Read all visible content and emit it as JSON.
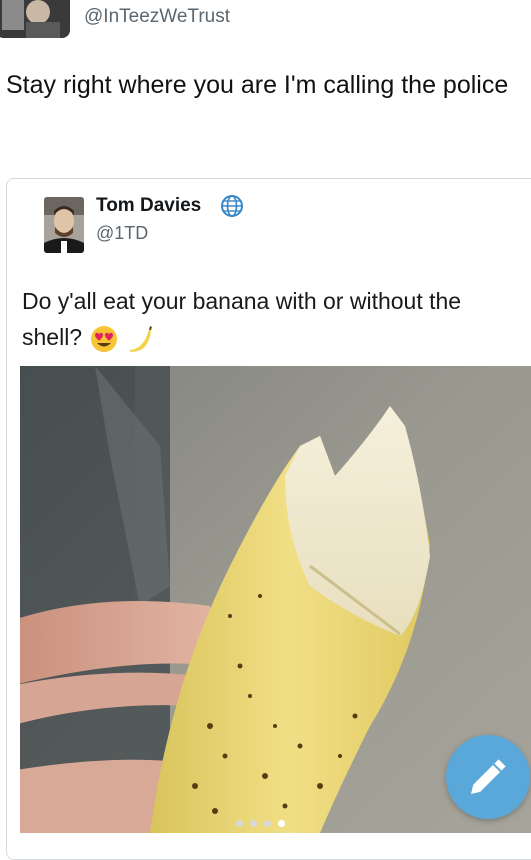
{
  "retweeter": {
    "handle": "@InTeezWeTrust",
    "caption": "Stay right where you are I'm calling the police"
  },
  "quoted_tweet": {
    "name": "Tom Davies",
    "handle": "@1TD",
    "text": "Do y'all eat your banana with or without the shell?",
    "emojis": [
      "heart-eyes-emoji",
      "banana-emoji"
    ],
    "verified_icon": "globe-icon",
    "photo": "hand-holding-bitten-unpeeled-banana"
  },
  "compose_button": {
    "icon": "pencil-icon"
  },
  "pager": {
    "count": 4,
    "active_index": 3
  },
  "colors": {
    "accent": "#5aa7d9",
    "text": "#14171a",
    "secondary_text": "#5b6770",
    "card_border": "#d6d9dc"
  }
}
